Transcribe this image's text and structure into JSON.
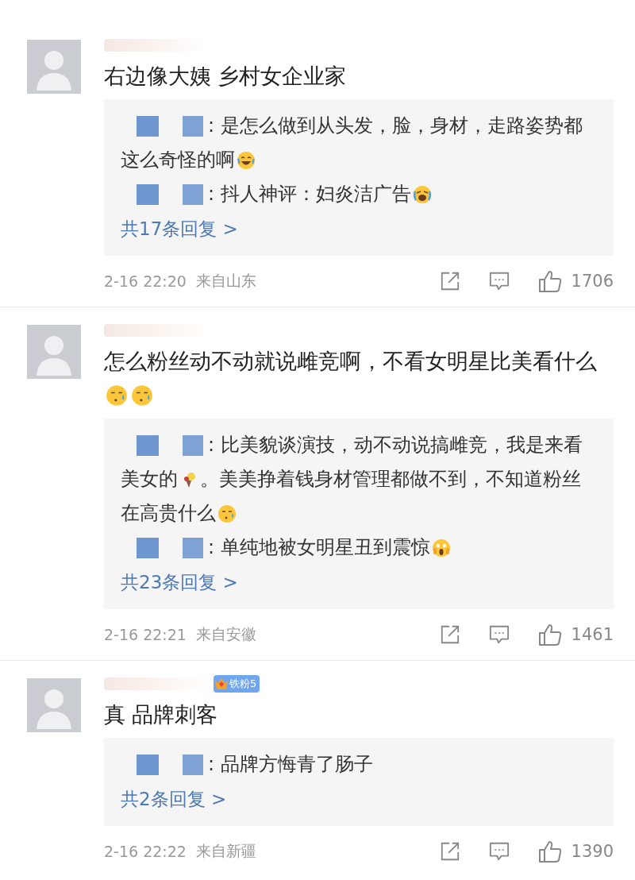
{
  "comments": [
    {
      "text": [
        {
          "kind": "text",
          "text": "右边像大姨 乡村女企业家"
        }
      ],
      "replies": [
        [
          {
            "kind": "text",
            "text": ": 是怎么做到从头发，脸，身材，走路姿势都这么奇怪的啊"
          },
          {
            "kind": "laugh"
          }
        ],
        [
          {
            "kind": "text",
            "text": ": 抖人神评：妇炎洁广告"
          },
          {
            "kind": "bawl"
          }
        ]
      ],
      "more": "共17条回复 >",
      "time": "2-16 22:20",
      "location": "来自山东",
      "likes": "1706"
    },
    {
      "text": [
        {
          "kind": "text",
          "text": "怎么粉丝动不动就说雌竞啊，不看女明星比美看什么"
        },
        {
          "kind": "sweat"
        },
        {
          "kind": "sweat"
        }
      ],
      "replies": [
        [
          {
            "kind": "text",
            "text": ": 比美貌谈演技，动不动说搞雌竞，我是来看美女的"
          },
          {
            "kind": "torch"
          },
          {
            "kind": "text",
            "text": "。美美挣着钱身材管理都做不到，不知道粉丝在高贵什么"
          },
          {
            "kind": "sweat"
          }
        ],
        [
          {
            "kind": "text",
            "text": ": 单纯地被女明星丑到震惊"
          },
          {
            "kind": "scream"
          }
        ]
      ],
      "more": "共23条回复 >",
      "time": "2-16 22:21",
      "location": "来自安徽",
      "likes": "1461"
    },
    {
      "badge": "铁粉5",
      "text": [
        {
          "kind": "text",
          "text": "真 品牌刺客"
        }
      ],
      "replies": [
        [
          {
            "kind": "text",
            "text": ": 品牌方悔青了肠子"
          }
        ]
      ],
      "more": "共2条回复 >",
      "time": "2-16 22:22",
      "location": "来自新疆",
      "likes": "1390"
    }
  ]
}
